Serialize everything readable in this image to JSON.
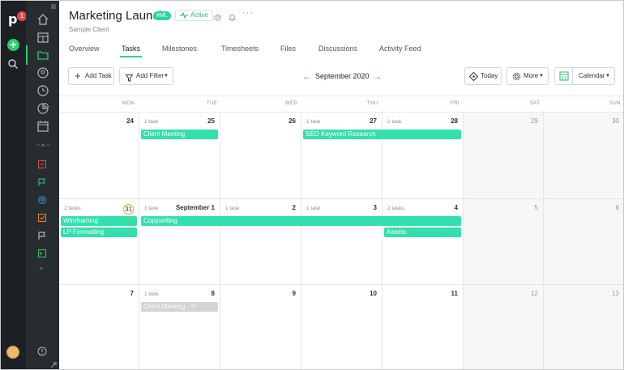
{
  "rail": {
    "logo_letter": "p",
    "notification_count": "1"
  },
  "sidebar": {
    "items": [
      "home-icon",
      "portfolio-icon",
      "projects-icon",
      "people-icon",
      "time-icon",
      "reports-icon",
      "calendar-icon",
      "collapse-icon",
      "project-item-red",
      "project-item-flag-green",
      "project-item-user-blue",
      "project-item-check-orange",
      "project-item-flag-white",
      "project-item-terminal-green",
      "add-project-icon",
      "info-icon",
      "tools-icon"
    ]
  },
  "header": {
    "title": "Marketing Launch",
    "tag": "#ML",
    "status": "Active",
    "client": "Sample Client",
    "more": "···"
  },
  "tabs": [
    "Overview",
    "Tasks",
    "Milestones",
    "Timesheets",
    "Files",
    "Discussions",
    "Activity Feed"
  ],
  "active_tab": "Tasks",
  "toolbar": {
    "add_task": "Add Task",
    "add_filter": "Add Filter",
    "month": "September 2020",
    "today": "Today",
    "more": "More",
    "view": "Calendar"
  },
  "colors": {
    "accent": "#2ecc71",
    "task_bar": "#33dfad",
    "task_bar_done": "#d4d4d4",
    "rail_bg": "#1d2125",
    "sidebar_bg": "#272c31"
  },
  "weekdays": [
    "MON",
    "TUE",
    "WED",
    "THU",
    "FRI",
    "SAT",
    "SUN"
  ],
  "weeks": [
    [
      {
        "day": "24",
        "tasks": ""
      },
      {
        "day": "25",
        "tasks": "1 task"
      },
      {
        "day": "26",
        "tasks": ""
      },
      {
        "day": "27",
        "tasks": "1 task"
      },
      {
        "day": "28",
        "tasks": "1 task"
      },
      {
        "day": "29",
        "tasks": ""
      },
      {
        "day": "30",
        "tasks": ""
      }
    ],
    [
      {
        "day": "31",
        "tasks": "2 tasks"
      },
      {
        "day": "September 1",
        "tasks": "1 task"
      },
      {
        "day": "2",
        "tasks": "1 task"
      },
      {
        "day": "3",
        "tasks": "1 task"
      },
      {
        "day": "4",
        "tasks": "2 tasks"
      },
      {
        "day": "5",
        "tasks": ""
      },
      {
        "day": "6",
        "tasks": ""
      }
    ],
    [
      {
        "day": "7",
        "tasks": ""
      },
      {
        "day": "8",
        "tasks": "1 task"
      },
      {
        "day": "9",
        "tasks": ""
      },
      {
        "day": "10",
        "tasks": ""
      },
      {
        "day": "11",
        "tasks": ""
      },
      {
        "day": "12",
        "tasks": ""
      },
      {
        "day": "13",
        "tasks": ""
      }
    ]
  ],
  "events": [
    {
      "name": "Client Meeting",
      "week": 0,
      "start": 1,
      "span": 1,
      "lane": 0,
      "done": false
    },
    {
      "name": "SEO Keyword Research",
      "week": 0,
      "start": 3,
      "span": 2,
      "lane": 0,
      "done": false
    },
    {
      "name": "Wireframing",
      "week": 1,
      "start": 0,
      "span": 1,
      "lane": 0,
      "done": false
    },
    {
      "name": "LP Formatting",
      "week": 1,
      "start": 0,
      "span": 1,
      "lane": 1,
      "done": false
    },
    {
      "name": "Copywriting",
      "week": 1,
      "start": 1,
      "span": 4,
      "lane": 0,
      "done": false
    },
    {
      "name": "Assets",
      "week": 1,
      "start": 4,
      "span": 1,
      "lane": 1,
      "done": false
    },
    {
      "name": "Client Meeting",
      "week": 2,
      "start": 1,
      "span": 1,
      "lane": 0,
      "done": true
    }
  ]
}
